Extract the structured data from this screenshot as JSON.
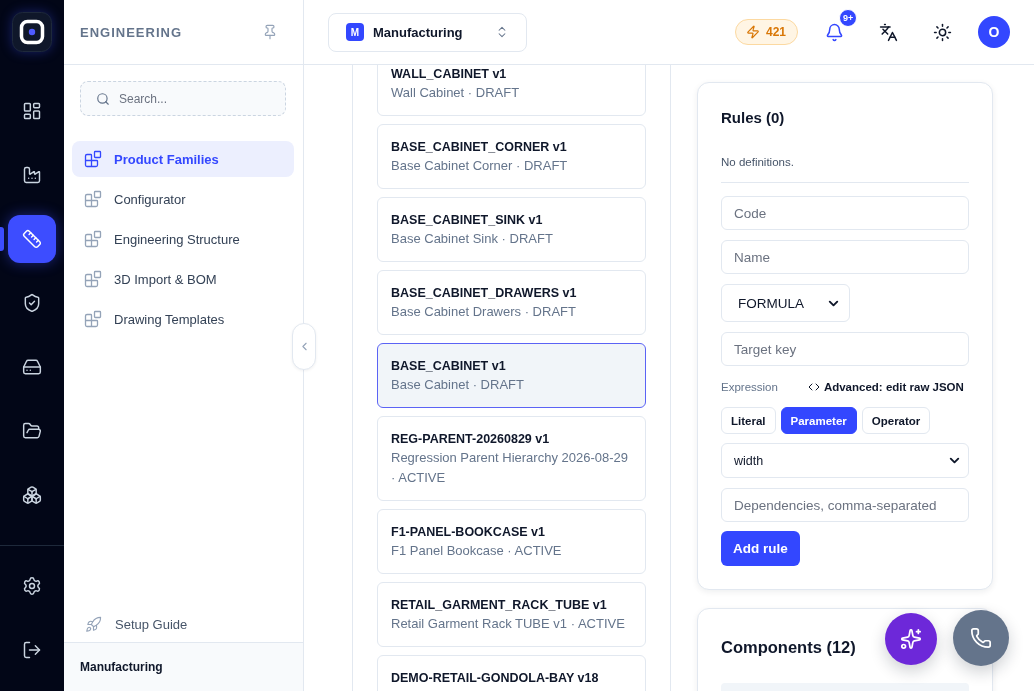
{
  "rail": {
    "items": [
      {
        "selected": false
      },
      {
        "selected": false
      },
      {
        "selected": true
      },
      {
        "selected": false
      },
      {
        "selected": false
      },
      {
        "selected": false
      },
      {
        "selected": false
      }
    ],
    "bottom_items": [
      {
        "selected": false
      },
      {
        "selected": false
      }
    ]
  },
  "sidebar": {
    "title": "ENGINEERING",
    "search": {
      "placeholder": "Search..."
    },
    "items": [
      {
        "label": "Product Families",
        "selected": true
      },
      {
        "label": "Configurator",
        "selected": false
      },
      {
        "label": "Engineering Structure",
        "selected": false
      },
      {
        "label": "3D Import & BOM",
        "selected": false
      },
      {
        "label": "Drawing Templates",
        "selected": false
      }
    ],
    "setup_guide": "Setup Guide",
    "footer": "Manufacturing"
  },
  "topbar": {
    "workspace": {
      "badge": "M",
      "name": "Manufacturing"
    },
    "credits": "421",
    "notification_count": "9+",
    "avatar": "O"
  },
  "families": [
    {
      "title": "WALL_CABINET v1",
      "subtitle": "Wall Cabinet · DRAFT",
      "selected": false
    },
    {
      "title": "BASE_CABINET_CORNER v1",
      "subtitle": "Base Cabinet Corner · DRAFT",
      "selected": false
    },
    {
      "title": "BASE_CABINET_SINK v1",
      "subtitle": "Base Cabinet Sink · DRAFT",
      "selected": false
    },
    {
      "title": "BASE_CABINET_DRAWERS v1",
      "subtitle": "Base Cabinet Drawers · DRAFT",
      "selected": false
    },
    {
      "title": "BASE_CABINET v1",
      "subtitle": "Base Cabinet · DRAFT",
      "selected": true
    },
    {
      "title": "REG-PARENT-20260829 v1",
      "subtitle": "Regression Parent Hierarchy 2026-08-29 · ACTIVE",
      "selected": false
    },
    {
      "title": "F1-PANEL-BOOKCASE v1",
      "subtitle": "F1 Panel Bookcase · ACTIVE",
      "selected": false
    },
    {
      "title": "RETAIL_GARMENT_RACK_TUBE v1",
      "subtitle": "Retail Garment Rack TUBE v1 · ACTIVE",
      "selected": false
    },
    {
      "title": "DEMO-RETAIL-GONDOLA-BAY v18",
      "selected": false
    }
  ],
  "rules": {
    "title": "Rules (0)",
    "empty_text": "No definitions.",
    "fields": [
      {
        "kind": "text",
        "placeholder": "Code"
      },
      {
        "kind": "text",
        "placeholder": "Name"
      },
      {
        "kind": "select",
        "value": "FORMULA"
      },
      {
        "kind": "text",
        "placeholder": "Target key"
      }
    ],
    "expression_label": "Expression",
    "advanced_link": "Advanced: edit raw JSON",
    "modes": [
      {
        "label": "Literal",
        "selected": false
      },
      {
        "label": "Parameter",
        "selected": true
      },
      {
        "label": "Operator",
        "selected": false
      }
    ],
    "parameter_select": {
      "value": "width"
    },
    "dependencies": {
      "placeholder": "Dependencies, comma-separated"
    },
    "submit": "Add rule"
  },
  "components": {
    "title": "Components (12)"
  }
}
